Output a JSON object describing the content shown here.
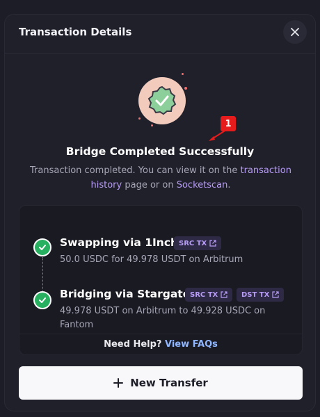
{
  "modal": {
    "title": "Transaction Details",
    "close_icon": "close-icon"
  },
  "status": {
    "icon": "check-badge-icon",
    "heading": "Bridge Completed Successfully",
    "text_before": "Transaction completed. You can view it on the ",
    "link_history": "transaction history",
    "text_middle": " page or on ",
    "link_socketscan": "Socketscan",
    "text_after": "."
  },
  "annotation": {
    "label": "1"
  },
  "steps": [
    {
      "title": "Swapping via 1Inch",
      "description": "50.0 USDC for 49.978 USDT on Arbitrum",
      "chips": [
        "SRC TX"
      ]
    },
    {
      "title": "Bridging via Stargate",
      "description": "49.978 USDT on Arbitrum to 49.928 USDC on Fantom",
      "chips": [
        "SRC TX",
        "DST TX"
      ]
    }
  ],
  "help": {
    "prefix": "Need Help? ",
    "link": "View FAQs"
  },
  "footer": {
    "button_label": "New Transfer",
    "button_icon": "plus-icon"
  },
  "colors": {
    "accent": "#b79cf5",
    "success": "#27b060",
    "badge": "#f3cbbd",
    "link_blue": "#8fb6ff"
  }
}
